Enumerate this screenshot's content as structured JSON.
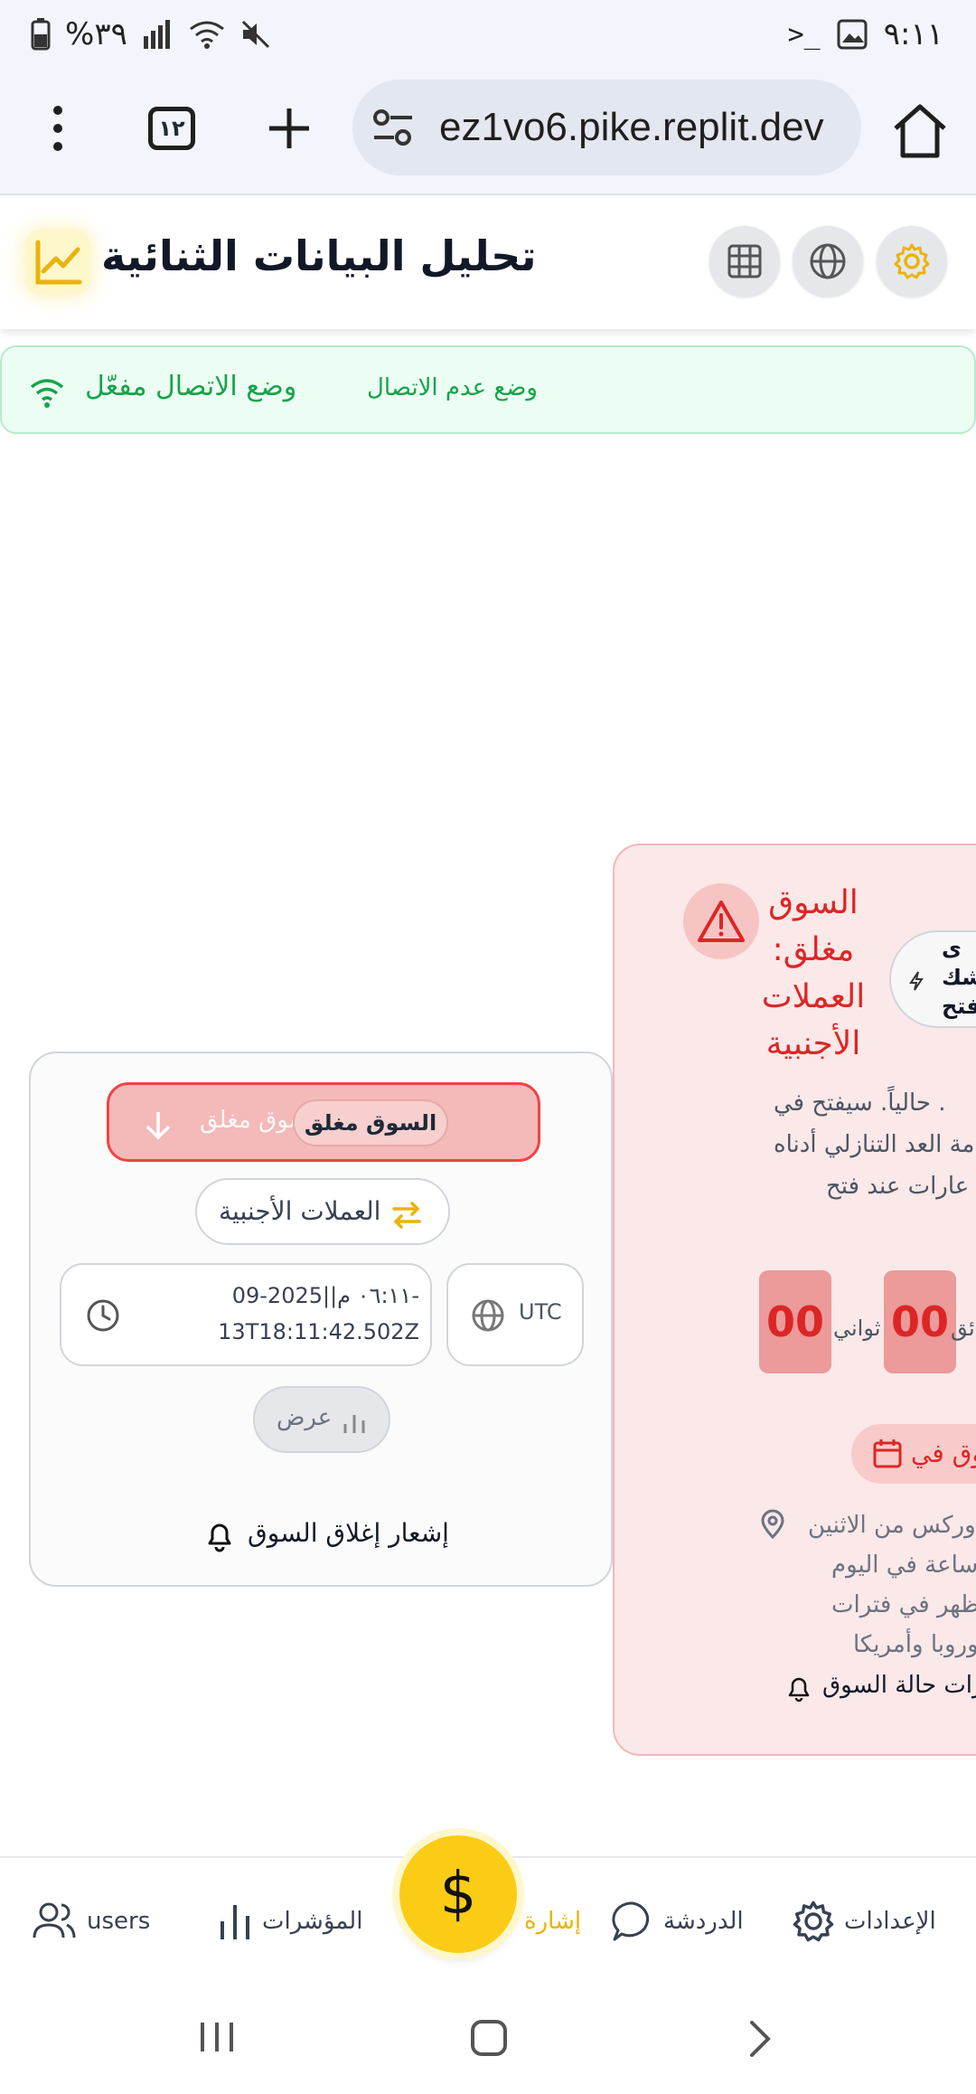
{
  "status_bar": {
    "time": "٩:١١",
    "battery": "%٣٩"
  },
  "browser": {
    "url": "ez1vo6.pike.replit.dev",
    "tab_count": "١٢"
  },
  "header": {
    "title": "تحليل البيانات الثنائية"
  },
  "offline_banner": {
    "enabled_label": "وضع الاتصال مفعّل",
    "mode_label": "وضع عدم الاتصال"
  },
  "market_card": {
    "status_chip": "السوق مغلق",
    "status_faded": "السوق مغلق",
    "fx_label": "العملات الأجنبية",
    "datetime_line1": "٠٦:١١ م||2025-09-",
    "datetime_line2": "13T18:11:42.502Z",
    "timezone": "UTC",
    "view_label": "عرض",
    "notify_label": "إشعار إغلاق السوق"
  },
  "market_detail": {
    "title": "السوق مغلق: العملات الأجنبية",
    "chip_line1": "ى",
    "chip_line2": "شك",
    "chip_line3": "فتح",
    "text_line1": "حالياً. سيفتح في .",
    "text_line2": "مة العد التنازلي أدناه",
    "text_line3": "عارات عند فتح",
    "countdown_a": "00",
    "countdown_b": "00",
    "label_seconds": "ثواني",
    "label_minutes": "ائق",
    "calendar_label": "وق في",
    "loc_line1": "ورکس من الاثنين",
    "loc_line2": "ساعة في اليوم.",
    "loc_line3": "تظهر في فترات",
    "loc_line4": "وروبا وأمريكا.",
    "notify_label": "رات حالة السوق"
  },
  "bottom_nav": {
    "settings": "الإعدادات",
    "chat": "الدردشة",
    "signal": "إشارة",
    "fab_symbol": "$",
    "indicators": "المؤشرات",
    "users": "users"
  },
  "colors": {
    "accent": "#facc15",
    "danger": "#dc2626",
    "success": "#16a34a"
  }
}
